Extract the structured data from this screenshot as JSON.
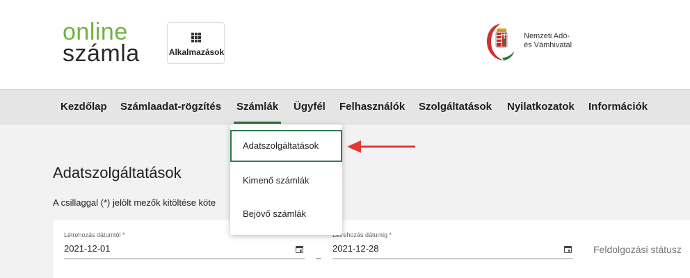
{
  "header": {
    "logo_line1": "online",
    "logo_line2": "számla",
    "apps_label": "Alkalmazások",
    "agency_line1": "Nemzeti Adó-",
    "agency_line2": "és Vámhivatal"
  },
  "nav": {
    "items": [
      "Kezdőlap",
      "Számlaadat-rögzítés",
      "Számlák",
      "Ügyfél",
      "Felhasználók",
      "Szolgáltatások",
      "Nyilatkozatok",
      "Információk"
    ],
    "active": "Számlák"
  },
  "dropdown": {
    "items": [
      "Adatszolgáltatások",
      "Kimenő számlák",
      "Bejövő számlák"
    ],
    "selected": "Adatszolgáltatások"
  },
  "page": {
    "title": "Adatszolgáltatások",
    "hint": "A csillaggal (*) jelölt mezők kitöltése köte"
  },
  "filters": {
    "from_label": "Létrehozás dátumtól *",
    "from_value": "2021-12-01",
    "to_label": "Létrehozás dátumig *",
    "to_value": "2021-12-28",
    "range_separator": "–",
    "status_placeholder": "Feldolgozási státusz"
  },
  "colors": {
    "brand_green": "#6cb33f",
    "accent_green": "#2e6b3a",
    "arrow_red": "#e53935"
  }
}
